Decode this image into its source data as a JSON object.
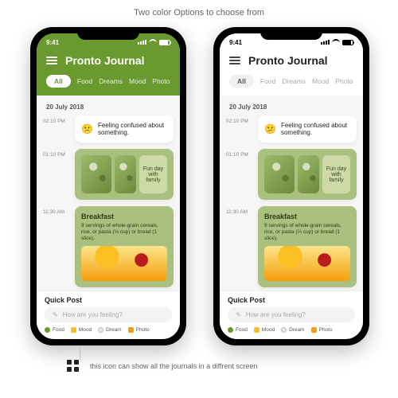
{
  "heading": "Two color Options to choose from",
  "footer_note": "this icon can show all the journals in a diffrent screen",
  "status": {
    "time": "9:41"
  },
  "app": {
    "title": "Pronto Journal",
    "tabs": [
      "All",
      "Food",
      "Dreams",
      "Mood",
      "Photo"
    ]
  },
  "feed": {
    "date": "20 July 2018",
    "entry1": {
      "time": "02:10 PM",
      "text": "Feeling confused about something."
    },
    "entry2": {
      "time": "01:10 PM",
      "caption": "Fun day with family"
    },
    "entry3": {
      "time": "11:30 AM",
      "title": "Breakfast",
      "sub": "9 servings of whole-grain cereals, rice, or pasta (⅓ cup) or bread (1 slice)."
    }
  },
  "quickpost": {
    "title": "Quick Post",
    "placeholder": "How are you feeling?",
    "chips": {
      "food": "Food",
      "mood": "Mood",
      "dream": "Dream",
      "photo": "Photo"
    }
  }
}
